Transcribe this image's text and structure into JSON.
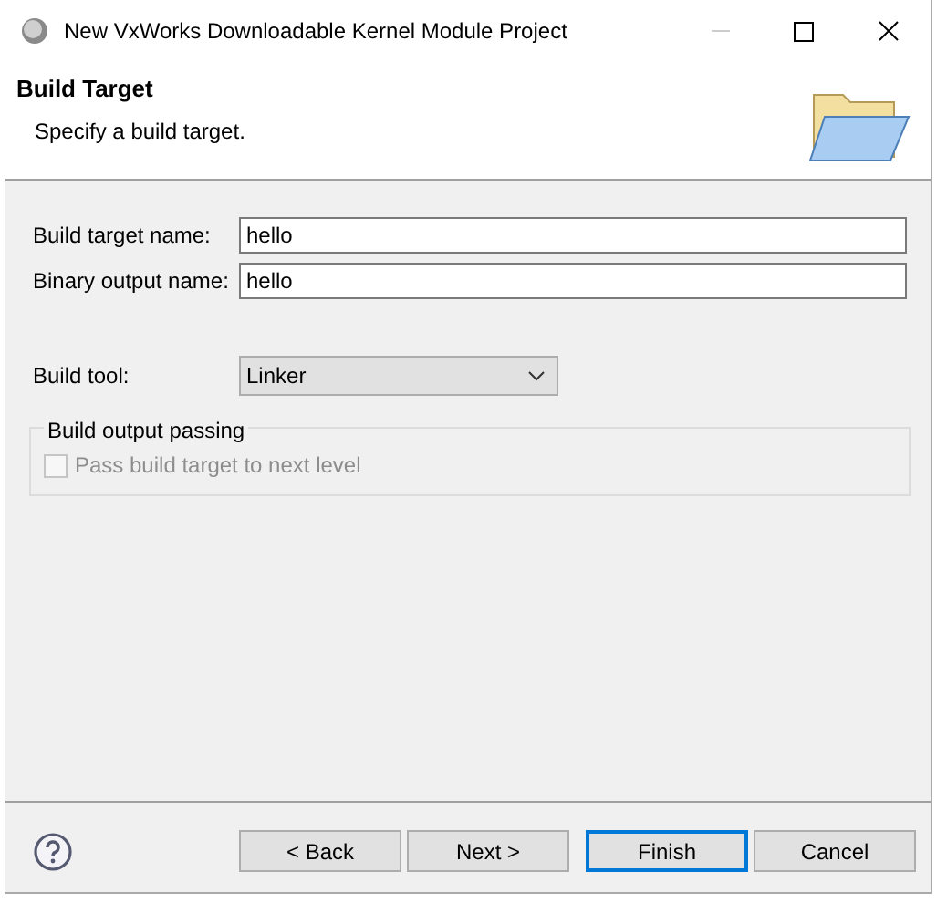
{
  "window": {
    "title": "New VxWorks Downloadable Kernel Module Project"
  },
  "header": {
    "title": "Build Target",
    "subtitle": "Specify a build target."
  },
  "fields": [
    {
      "label": "Build target name:",
      "value": "hello"
    },
    {
      "label": "Binary output name:",
      "value": "hello"
    }
  ],
  "build_tool": {
    "label": "Build tool:",
    "value": "Linker"
  },
  "group": {
    "title": "Build output passing",
    "checkbox": {
      "label": "Pass build target to next level",
      "checked": false,
      "disabled": true
    }
  },
  "buttons": [
    {
      "label": "< Back",
      "default": false
    },
    {
      "label": "Next >",
      "default": false
    },
    {
      "label": "Finish",
      "default": true
    },
    {
      "label": "Cancel",
      "default": false
    }
  ]
}
